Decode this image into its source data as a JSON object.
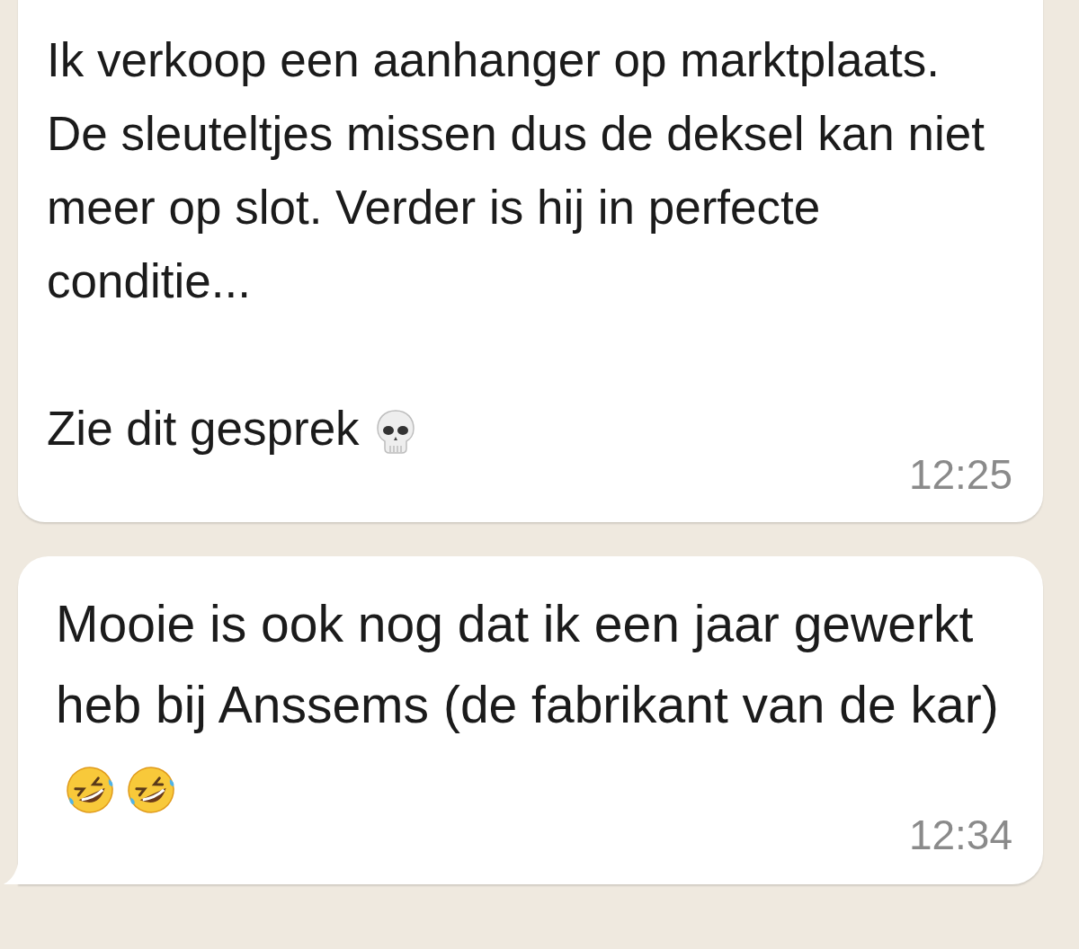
{
  "messages": [
    {
      "text": "Ik verkoop een aanhanger op marktplaats. De sleuteltjes missen dus de deksel kan niet meer op slot. Verder is hij in perfecte conditie...\n\nZie dit gesprek",
      "time": "12:25",
      "emojis": [
        {
          "kind": "skull"
        }
      ],
      "tail": false
    },
    {
      "text": "Mooie is ook nog dat ik een jaar gewerkt heb bij Anssems (de fabrikant van de kar)",
      "time": "12:34",
      "emojis": [
        {
          "kind": "rofl"
        },
        {
          "kind": "rofl"
        }
      ],
      "tail": true
    }
  ]
}
